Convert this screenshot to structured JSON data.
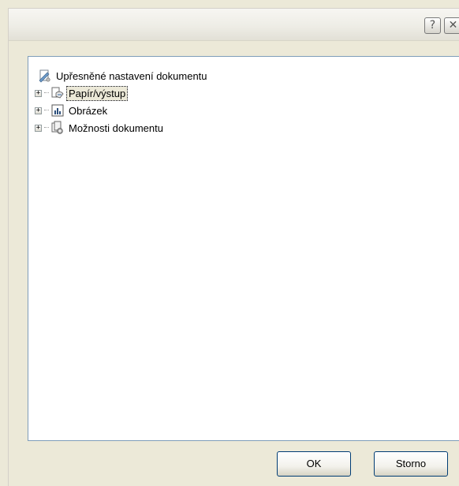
{
  "window": {
    "help_button": "?",
    "close_button": "✕"
  },
  "tree": {
    "root_label": "Upřesněné nastavení dokumentu",
    "root_icon": "document-settings-icon",
    "children": [
      {
        "label": "Papír/výstup",
        "icon": "paper-output-icon",
        "expander": "+",
        "selected": true
      },
      {
        "label": "Obrázek",
        "icon": "graphics-icon",
        "expander": "+",
        "selected": false
      },
      {
        "label": "Možnosti dokumentu",
        "icon": "document-options-icon",
        "expander": "+",
        "selected": false
      }
    ]
  },
  "footer": {
    "ok_label": "OK",
    "cancel_label": "Storno"
  }
}
